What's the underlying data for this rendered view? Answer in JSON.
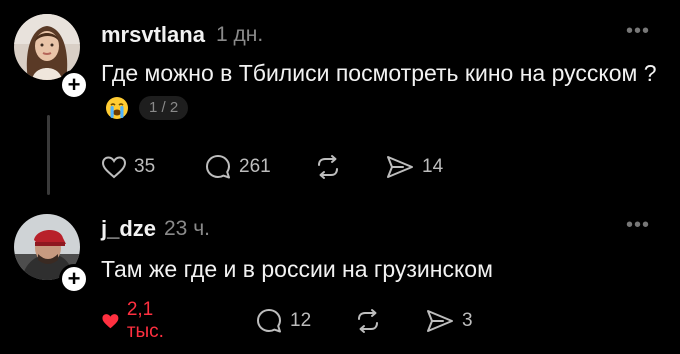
{
  "posts": [
    {
      "username": "mrsvtlana",
      "time": "1 дн.",
      "text": "Где можно в Тбилиси посмотреть кино на русском ?",
      "emoji": "crying-face",
      "counter": "1 / 2",
      "likes": "35",
      "comments": "261",
      "shares": "14",
      "liked": false
    },
    {
      "username": "j_dze",
      "time": "23 ч.",
      "text": "Там же где и в россии на грузинском",
      "likes": "2,1 тыс.",
      "comments": "12",
      "shares": "3",
      "liked": true
    }
  ],
  "more_label": "•••",
  "plus_label": "+",
  "colors": {
    "like_active": "#ff3040",
    "muted": "#8a8a8a",
    "background": "#000000"
  }
}
